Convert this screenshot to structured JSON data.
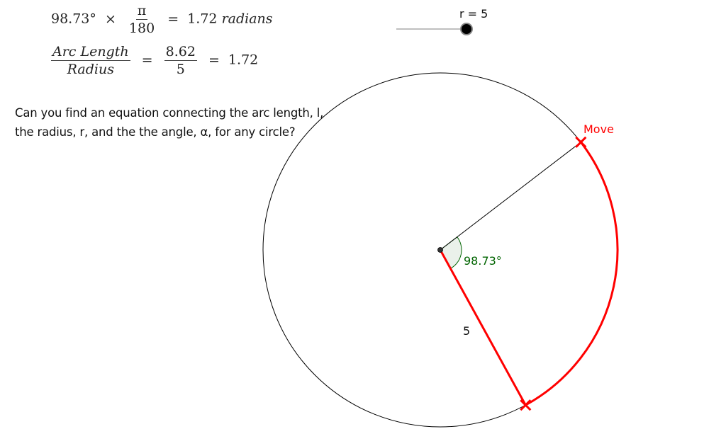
{
  "equation1": {
    "angle": "98.73°",
    "times": "×",
    "frac_num": "π",
    "frac_den": "180",
    "equals": "=",
    "result": "1.72",
    "unit": "radians"
  },
  "equation2": {
    "num_label": "Arc Length",
    "den_label": "Radius",
    "equals1": "=",
    "num_value": "8.62",
    "den_value": "5",
    "equals2": "=",
    "result": "1.72"
  },
  "question": {
    "line1": "Can you find an equation connecting the arc length, l,",
    "line2": "the radius, r, and the the angle, α, for any circle?"
  },
  "slider": {
    "label": "r = 5",
    "value": 5
  },
  "diagram": {
    "angle_label": "98.73°",
    "radius_label": "5",
    "move_label": "Move",
    "angle_degrees": 98.73,
    "colors": {
      "arc": "#ff0000",
      "radius": "#ff0000",
      "circle": "#000000",
      "angle_text": "#006400",
      "angle_fill": "#e8f0e8",
      "move_text": "#ff0000"
    }
  }
}
